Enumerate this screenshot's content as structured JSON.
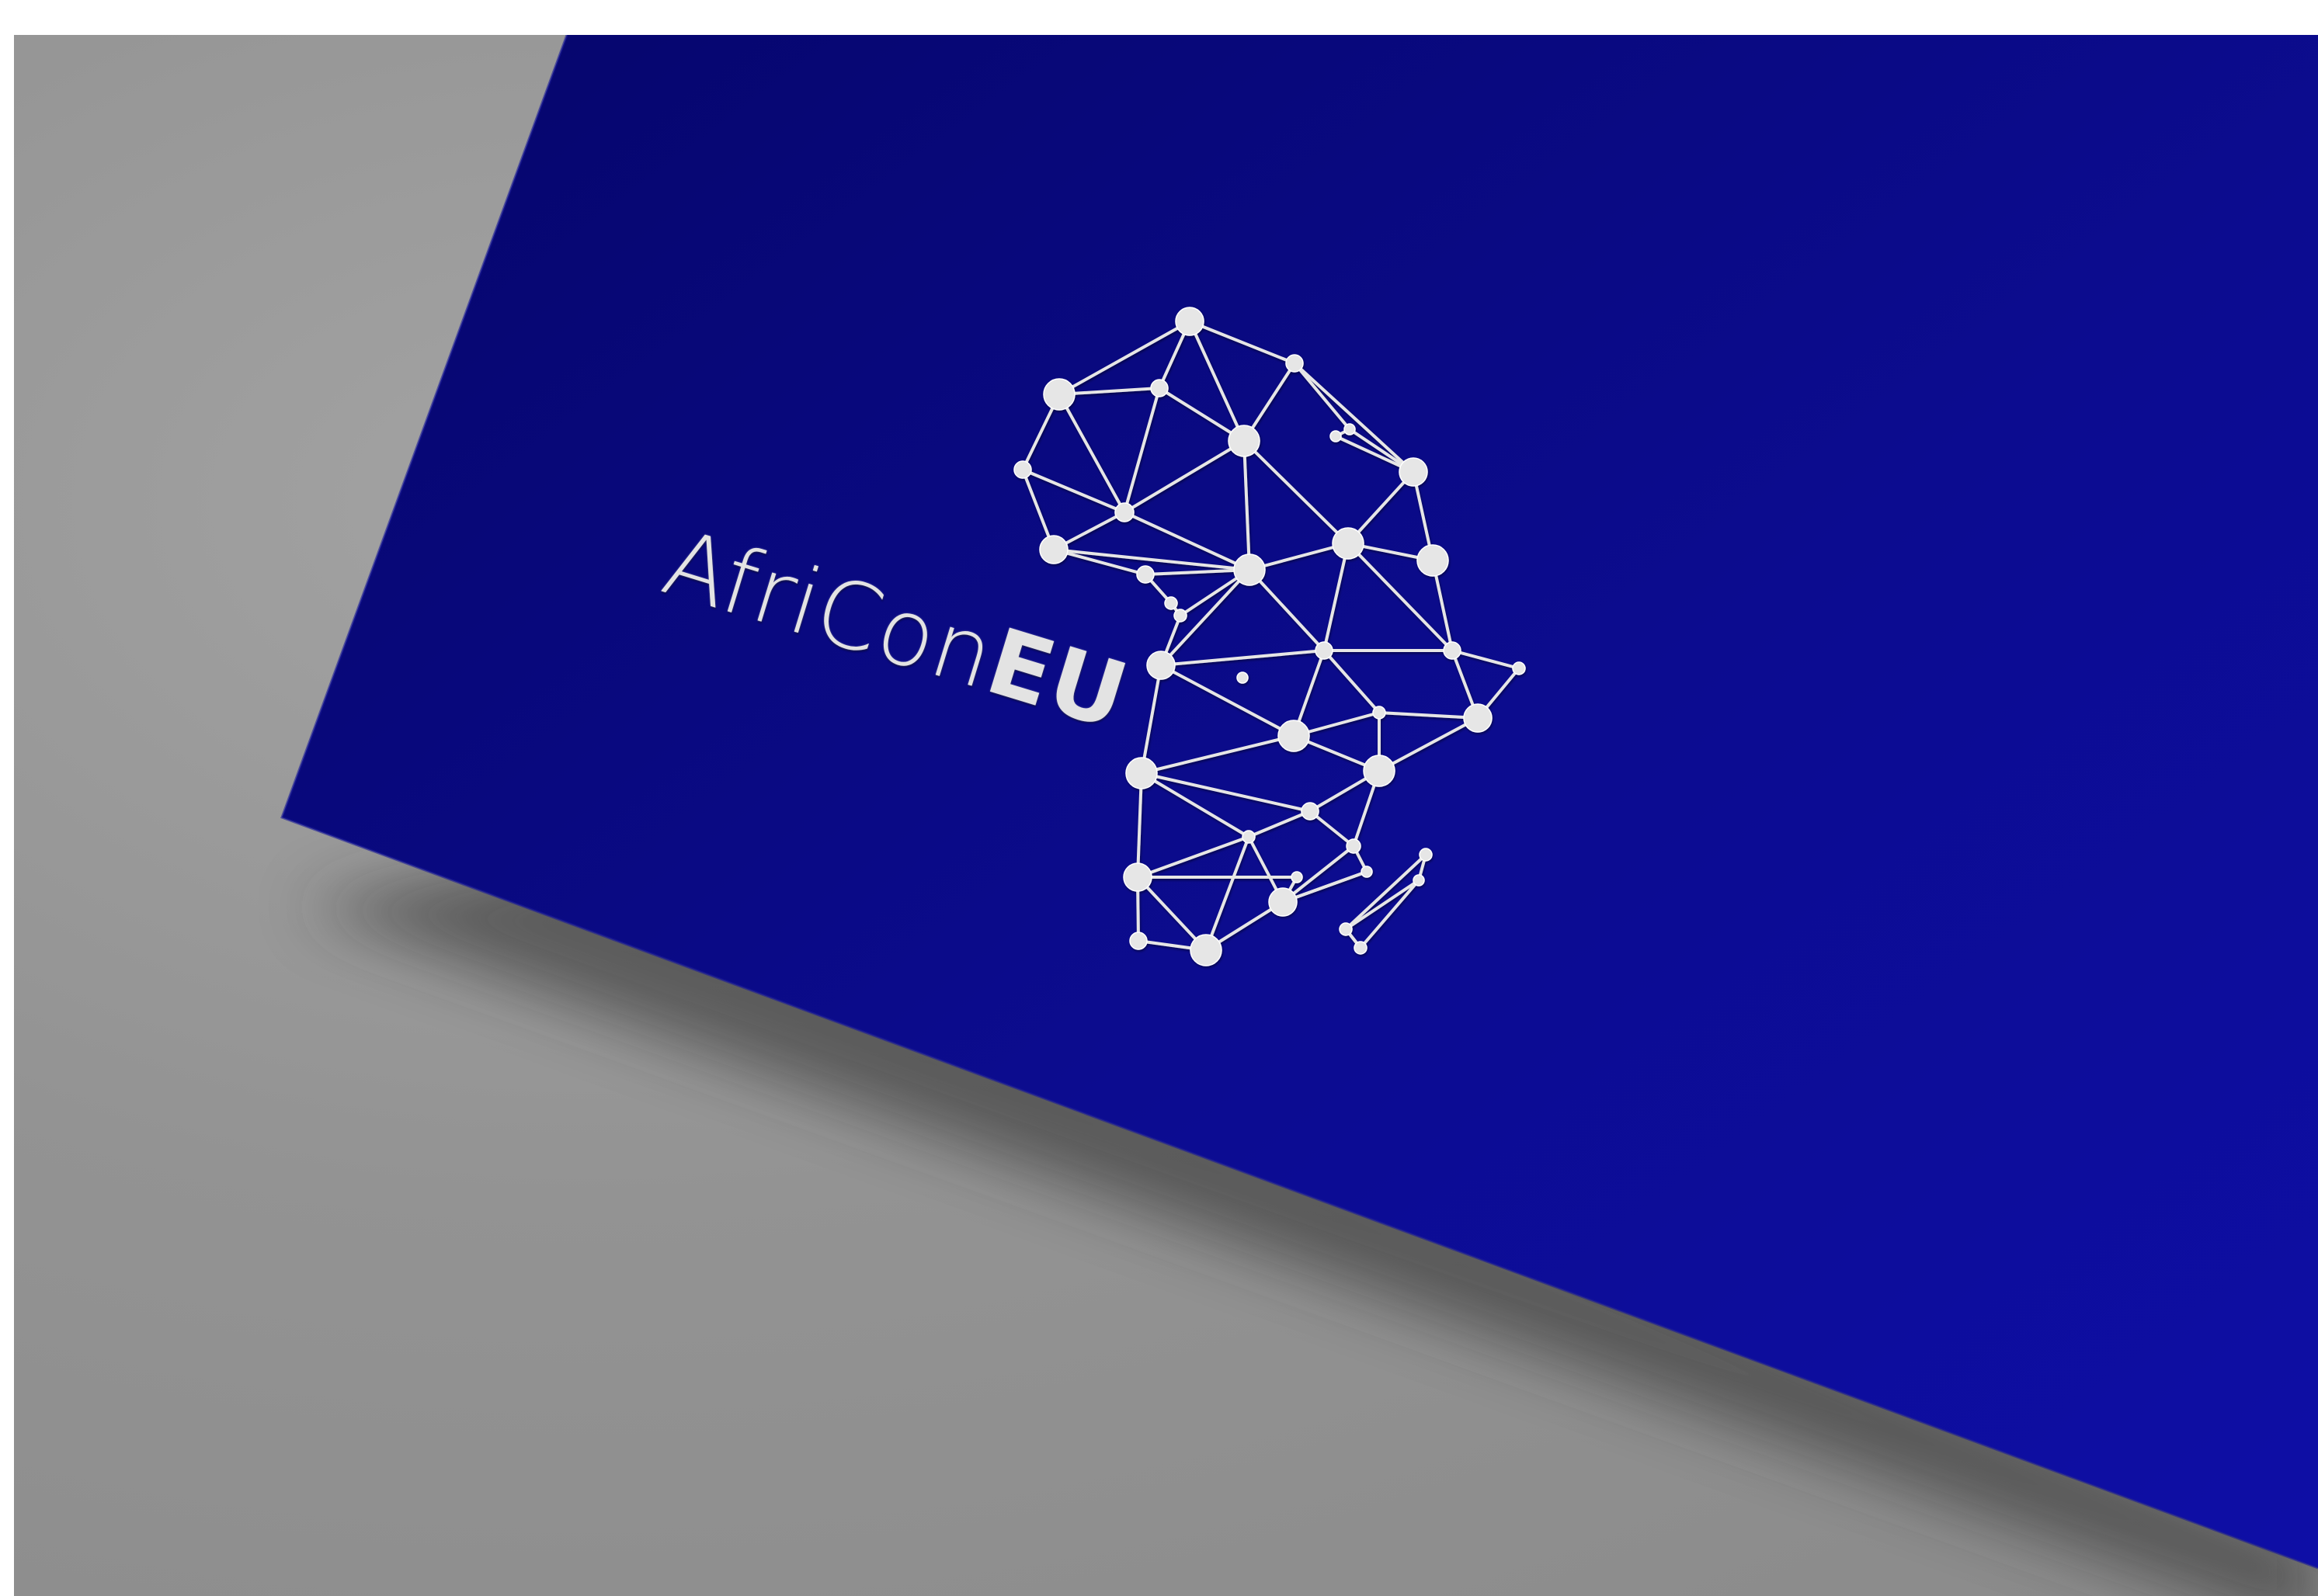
{
  "logo": {
    "name_regular": "AfriCon",
    "name_bold": "EU",
    "icon": "africa-network-map-icon"
  },
  "colors": {
    "card": "#0a0a86",
    "card_light": "#1010a2",
    "background": "#9a9a9a",
    "foil": "#e6e6e6"
  }
}
